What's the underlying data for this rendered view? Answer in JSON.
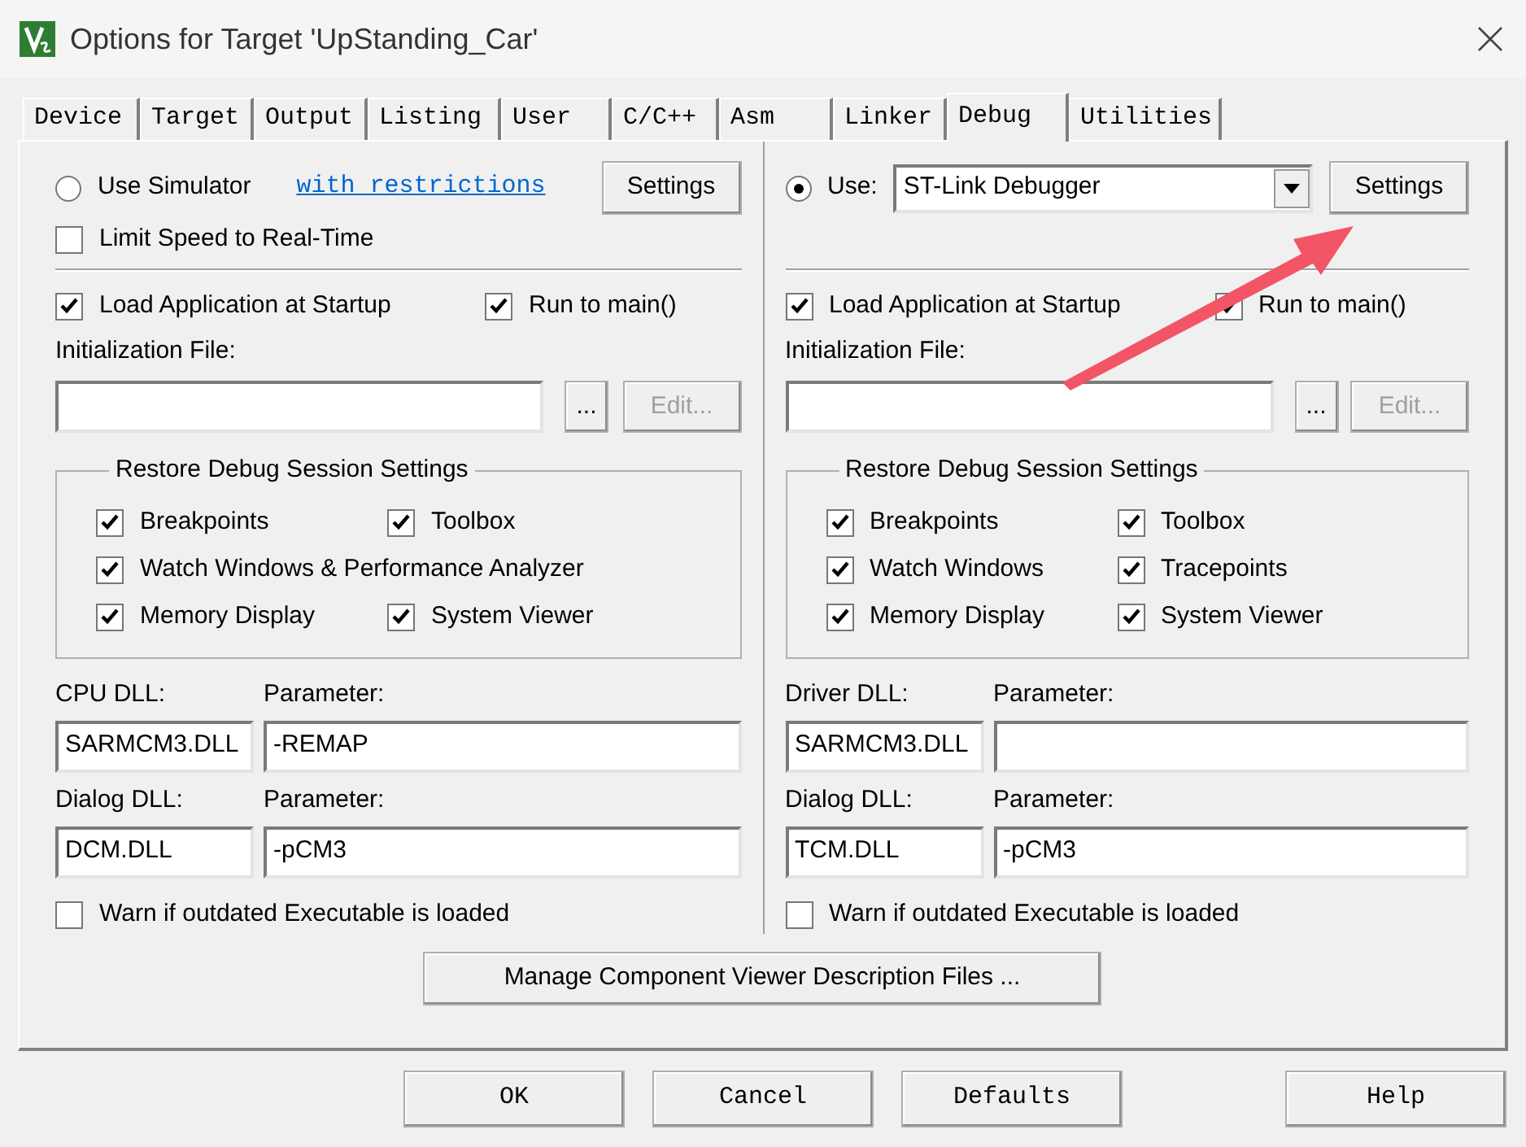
{
  "window": {
    "title": "Options for Target 'UpStanding_Car'"
  },
  "tabs": [
    {
      "label": "Device",
      "selected": false
    },
    {
      "label": "Target",
      "selected": false
    },
    {
      "label": "Output",
      "selected": false
    },
    {
      "label": "Listing",
      "selected": false
    },
    {
      "label": "User",
      "selected": false
    },
    {
      "label": "C/C++",
      "selected": false
    },
    {
      "label": "Asm",
      "selected": false
    },
    {
      "label": "Linker",
      "selected": false
    },
    {
      "label": "Debug",
      "selected": true
    },
    {
      "label": "Utilities",
      "selected": false
    }
  ],
  "left": {
    "mode": {
      "label": "Use Simulator",
      "selected": false,
      "link": "with restrictions",
      "settings": "Settings"
    },
    "limit_speed": {
      "label": "Limit Speed to Real-Time",
      "checked": false
    },
    "load_app": {
      "label": "Load Application at Startup",
      "checked": true
    },
    "run_to_main": {
      "label": "Run to main()",
      "checked": true
    },
    "init_label": "Initialization File:",
    "browse": "...",
    "edit": {
      "label": "Edit...",
      "disabled": true
    },
    "restore": {
      "title": "Restore Debug Session Settings",
      "rows": [
        [
          {
            "label": "Breakpoints",
            "checked": true
          },
          {
            "label": "Toolbox",
            "checked": true
          }
        ],
        [
          {
            "label": "Watch Windows & Performance Analyzer",
            "checked": true
          }
        ],
        [
          {
            "label": "Memory Display",
            "checked": true
          },
          {
            "label": "System Viewer",
            "checked": true
          }
        ]
      ]
    },
    "dll_rows": [
      {
        "dll_label": "CPU DLL:",
        "dll_value": "SARMCM3.DLL",
        "param_label": "Parameter:",
        "param_value": "-REMAP"
      },
      {
        "dll_label": "Dialog DLL:",
        "dll_value": "DCM.DLL",
        "param_label": "Parameter:",
        "param_value": "-pCM3"
      }
    ],
    "warn": {
      "label": "Warn if outdated Executable is loaded",
      "checked": false
    }
  },
  "right": {
    "mode": {
      "label": "Use:",
      "selected": true,
      "dropdown": "ST-Link Debugger",
      "settings": "Settings"
    },
    "load_app": {
      "label": "Load Application at Startup",
      "checked": true
    },
    "run_to_main": {
      "label": "Run to main()",
      "checked": true
    },
    "init_label": "Initialization File:",
    "browse": "...",
    "edit": {
      "label": "Edit...",
      "disabled": true
    },
    "restore": {
      "title": "Restore Debug Session Settings",
      "rows": [
        [
          {
            "label": "Breakpoints",
            "checked": true
          },
          {
            "label": "Toolbox",
            "checked": true
          }
        ],
        [
          {
            "label": "Watch Windows",
            "checked": true
          },
          {
            "label": "Tracepoints",
            "checked": true
          }
        ],
        [
          {
            "label": "Memory Display",
            "checked": true
          },
          {
            "label": "System Viewer",
            "checked": true
          }
        ]
      ]
    },
    "dll_rows": [
      {
        "dll_label": "Driver DLL:",
        "dll_value": "SARMCM3.DLL",
        "param_label": "Parameter:"
      },
      {
        "dll_label": "Dialog DLL:",
        "dll_value": "TCM.DLL",
        "param_label": "Parameter:",
        "param_value": "-pCM3"
      }
    ],
    "warn": {
      "label": "Warn if outdated Executable is loaded",
      "checked": false
    }
  },
  "manage_button": "Manage Component Viewer Description Files ...",
  "buttons": [
    "OK",
    "Cancel",
    "Defaults",
    "Help"
  ]
}
